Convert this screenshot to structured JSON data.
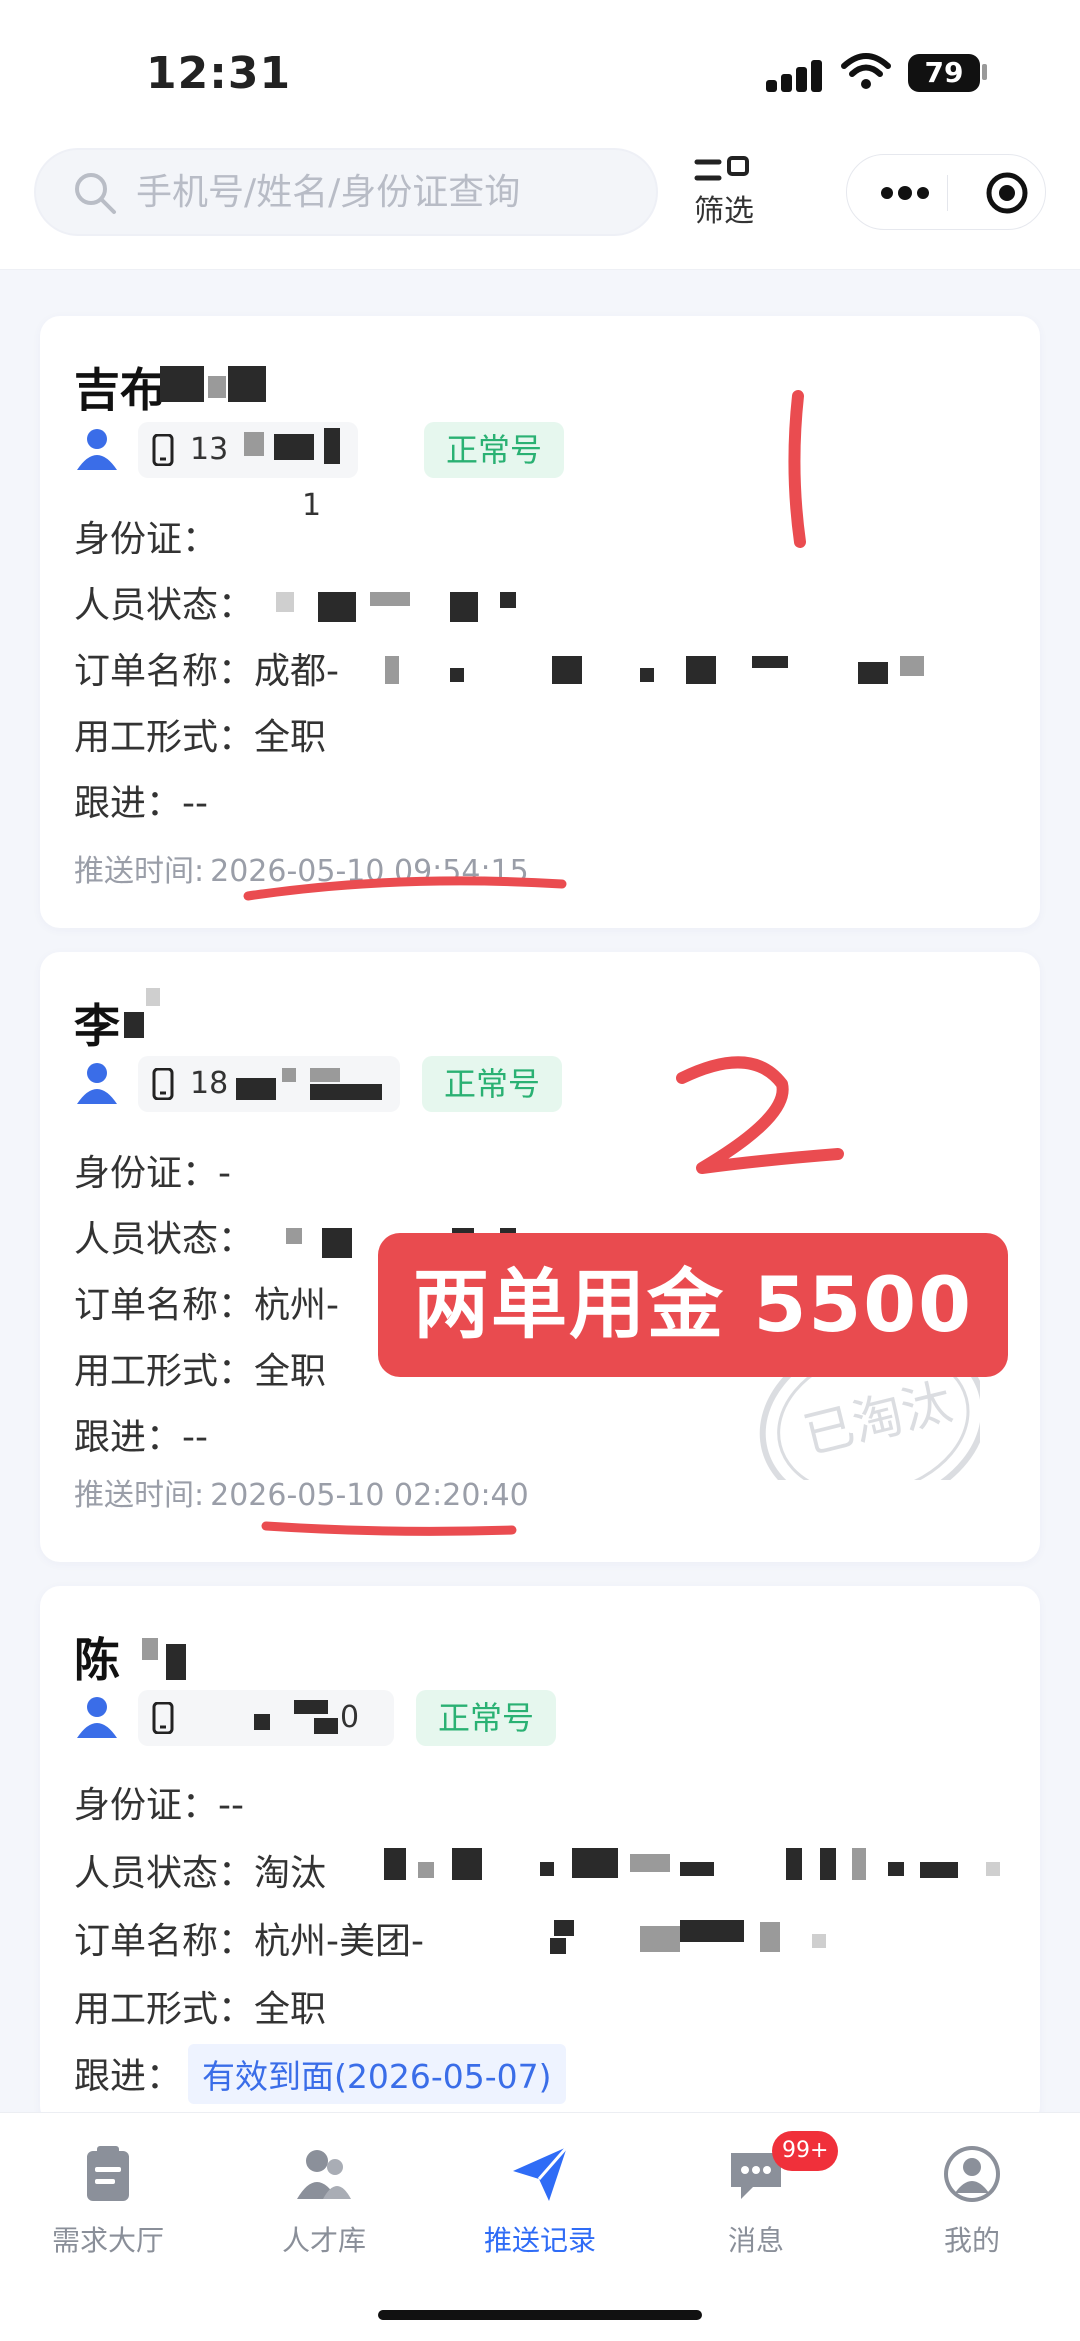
{
  "status_bar": {
    "time": "12:31",
    "battery": "79"
  },
  "header": {
    "search_placeholder": "手机号/姓名/身份证查询",
    "filter_label": "筛选"
  },
  "cards": [
    {
      "name": "吉布",
      "phone": "13",
      "phone_suffix": "1",
      "tag": "正常号",
      "id_label": "身份证：",
      "id_value": "",
      "status_label": "人员状态：",
      "status_value": "",
      "order_label": "订单名称：",
      "order_value": "成都-",
      "employ_label": "用工形式：",
      "employ_value": "全职",
      "follow_label": "跟进：",
      "follow_value": "--",
      "push_label": "推送时间:",
      "push_time": "2026-05-10 09:54:15"
    },
    {
      "name": "李",
      "phone": "18",
      "tag": "正常号",
      "id_label": "身份证：",
      "id_value": "-",
      "status_label": "人员状态：",
      "status_value": "",
      "order_label": "订单名称：",
      "order_value": "杭州-",
      "employ_label": "用工形式：",
      "employ_value": "全职",
      "follow_label": "跟进：",
      "follow_value": "--",
      "push_label": "推送时间:",
      "push_time": "2026-05-10 02:20:40"
    },
    {
      "name": "陈",
      "phone": "",
      "phone_suffix": "0",
      "tag": "正常号",
      "id_label": "身份证：",
      "id_value": "--",
      "status_label": "人员状态：",
      "status_value": "淘汰",
      "order_label": "订单名称：",
      "order_value": "杭州-美团-",
      "employ_label": "用工形式：",
      "employ_value": "全职",
      "follow_label": "跟进：",
      "follow_value": "有效到面(2026-05-07)",
      "stamp_text": "已淘汰"
    }
  ],
  "annotations": {
    "number_one": "1",
    "number_two": "2",
    "banner": "两单用金 5500"
  },
  "tabbar": {
    "tabs": [
      {
        "label": "需求大厅",
        "icon": "clipboard-icon"
      },
      {
        "label": "人才库",
        "icon": "people-icon"
      },
      {
        "label": "推送记录",
        "icon": "send-icon",
        "active": true
      },
      {
        "label": "消息",
        "icon": "chat-icon",
        "badge": "99+"
      },
      {
        "label": "我的",
        "icon": "profile-icon"
      }
    ]
  },
  "colors": {
    "accent": "#2f6cf6",
    "tag_green": "#2ab173",
    "annotation_red": "#e94b4f",
    "badge_red": "#f0303a"
  }
}
